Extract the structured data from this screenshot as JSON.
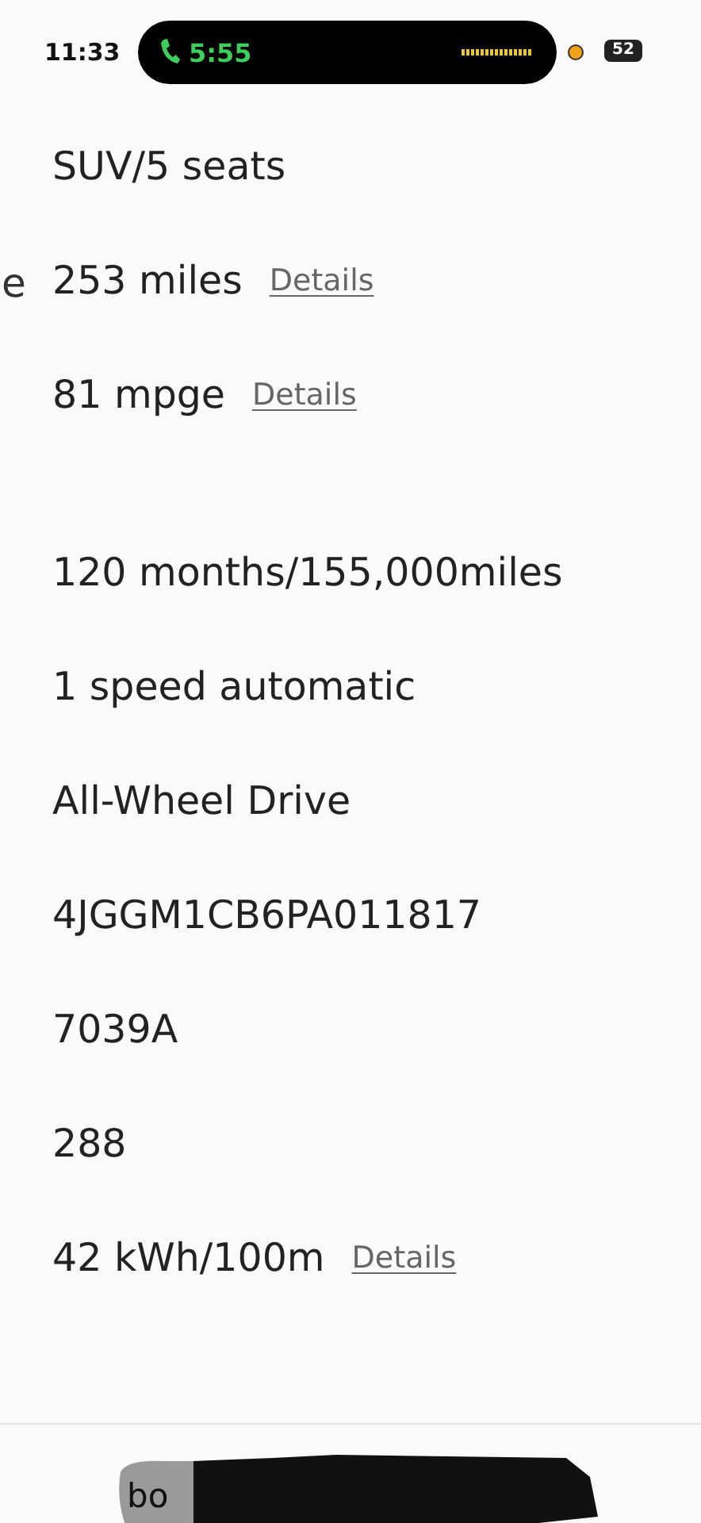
{
  "status_bar": {
    "time": "11:33",
    "call_time": "5:55",
    "battery": "52"
  },
  "side_label": "e",
  "spec_groups": [
    {
      "rows": [
        {
          "value": "SUV/5 seats"
        },
        {
          "value": "253 miles",
          "link": "Details"
        },
        {
          "value": "81 mpge",
          "link": "Details"
        }
      ]
    },
    {
      "rows": [
        {
          "value": "120 months/155,000miles"
        },
        {
          "value": "1 speed automatic"
        },
        {
          "value": "All-Wheel Drive"
        },
        {
          "value": "4JGGM1CB6PA011817"
        },
        {
          "value": "7039A"
        },
        {
          "value": "288"
        },
        {
          "value": "42 kWh/100m",
          "link": "Details"
        }
      ]
    }
  ],
  "bottom_bar": {
    "text": "bo"
  }
}
